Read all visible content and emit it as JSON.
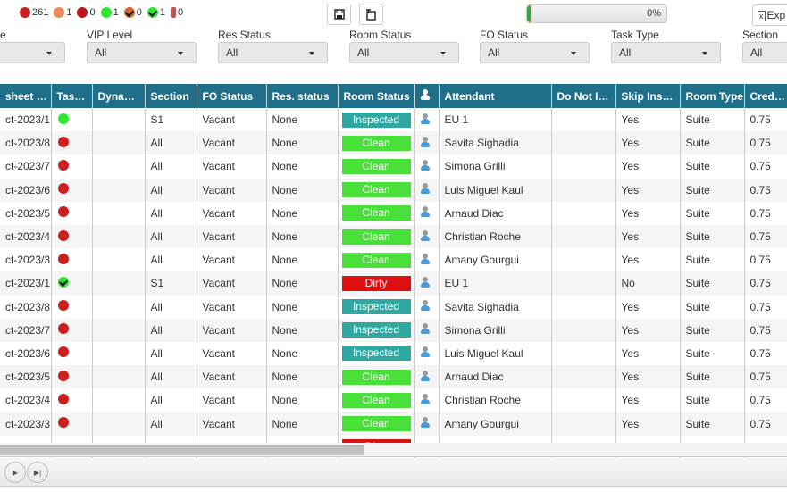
{
  "status_counts": [
    {
      "icon": "red-dot-icon",
      "color": "#cc1f1f",
      "count": "261",
      "check": false
    },
    {
      "icon": "orange-dot-icon",
      "color": "#ee8a55",
      "count": "1",
      "check": false
    },
    {
      "icon": "red-pause-icon",
      "color": "#c0141a",
      "count": "0",
      "check": false
    },
    {
      "icon": "green-dot-icon",
      "color": "#2ee62e",
      "count": "1",
      "check": false
    },
    {
      "icon": "orange-check-icon",
      "color": "#d9622b",
      "count": "0",
      "check": true
    },
    {
      "icon": "green-check-icon",
      "color": "#2ee62e",
      "count": "1",
      "check": true
    },
    {
      "icon": "tag-icon",
      "color": "#b85555",
      "count": "0",
      "check": false
    }
  ],
  "toolbar": {
    "progress_label": "0%",
    "progress_value": 0,
    "export_label": "Exp"
  },
  "filters": [
    {
      "label": "e",
      "value": ""
    },
    {
      "label": "VIP Level",
      "value": "All"
    },
    {
      "label": "Res Status",
      "value": "All"
    },
    {
      "label": "Room Status",
      "value": "All"
    },
    {
      "label": "FO Status",
      "value": "All"
    },
    {
      "label": "Task Type",
      "value": "All"
    },
    {
      "label": "Section",
      "value": "All"
    }
  ],
  "columns": [
    "sheet na…",
    "Tas…",
    "Dyna…",
    "Section",
    "FO Status",
    "Res. status",
    "Room Status",
    "",
    "Attendant",
    "Do Not In…",
    "Skip Insp…",
    "Room Type",
    "Credits"
  ],
  "colors": {
    "Inspected": "#2ea8a0",
    "Clean": "#4ae03a",
    "Dirty": "#e01010",
    "header": "#1f6f8b"
  },
  "rows": [
    {
      "sheet": "ct-2023/1",
      "task": "green",
      "section": "S1",
      "fo": "Vacant",
      "res": "None",
      "room": "Inspected",
      "attendant": "EU 1",
      "dni": "",
      "skip": "Yes",
      "type": "Suite",
      "credits": "0.75"
    },
    {
      "sheet": "ct-2023/8…",
      "task": "red",
      "section": "All",
      "fo": "Vacant",
      "res": "None",
      "room": "Clean",
      "attendant": "Savita Sighadia",
      "dni": "",
      "skip": "Yes",
      "type": "Suite",
      "credits": "0.75"
    },
    {
      "sheet": "ct-2023/7…",
      "task": "red",
      "section": "All",
      "fo": "Vacant",
      "res": "None",
      "room": "Clean",
      "attendant": "Simona Grilli",
      "dni": "",
      "skip": "Yes",
      "type": "Suite",
      "credits": "0.75"
    },
    {
      "sheet": "ct-2023/6…",
      "task": "red",
      "section": "All",
      "fo": "Vacant",
      "res": "None",
      "room": "Clean",
      "attendant": "Luis Miguel Kaul",
      "dni": "",
      "skip": "Yes",
      "type": "Suite",
      "credits": "0.75"
    },
    {
      "sheet": "ct-2023/5…",
      "task": "red",
      "section": "All",
      "fo": "Vacant",
      "res": "None",
      "room": "Clean",
      "attendant": "Arnaud Diac",
      "dni": "",
      "skip": "Yes",
      "type": "Suite",
      "credits": "0.75"
    },
    {
      "sheet": "ct-2023/4…",
      "task": "red",
      "section": "All",
      "fo": "Vacant",
      "res": "None",
      "room": "Clean",
      "attendant": "Christian Roche",
      "dni": "",
      "skip": "Yes",
      "type": "Suite",
      "credits": "0.75"
    },
    {
      "sheet": "ct-2023/3…",
      "task": "red",
      "section": "All",
      "fo": "Vacant",
      "res": "None",
      "room": "Clean",
      "attendant": "Amany Gourgui",
      "dni": "",
      "skip": "Yes",
      "type": "Suite",
      "credits": "0.75"
    },
    {
      "sheet": "ct-2023/1",
      "task": "green-check",
      "section": "S1",
      "fo": "Vacant",
      "res": "None",
      "room": "Dirty",
      "attendant": "EU 1",
      "dni": "",
      "skip": "No",
      "type": "Suite",
      "credits": "0.75"
    },
    {
      "sheet": "ct-2023/8…",
      "task": "red",
      "section": "All",
      "fo": "Vacant",
      "res": "None",
      "room": "Inspected",
      "attendant": "Savita Sighadia",
      "dni": "",
      "skip": "Yes",
      "type": "Suite",
      "credits": "0.75"
    },
    {
      "sheet": "ct-2023/7…",
      "task": "red",
      "section": "All",
      "fo": "Vacant",
      "res": "None",
      "room": "Inspected",
      "attendant": "Simona Grilli",
      "dni": "",
      "skip": "Yes",
      "type": "Suite",
      "credits": "0.75"
    },
    {
      "sheet": "ct-2023/6…",
      "task": "red",
      "section": "All",
      "fo": "Vacant",
      "res": "None",
      "room": "Inspected",
      "attendant": "Luis Miguel Kaul",
      "dni": "",
      "skip": "Yes",
      "type": "Suite",
      "credits": "0.75"
    },
    {
      "sheet": "ct-2023/5…",
      "task": "red",
      "section": "All",
      "fo": "Vacant",
      "res": "None",
      "room": "Clean",
      "attendant": "Arnaud Diac",
      "dni": "",
      "skip": "Yes",
      "type": "Suite",
      "credits": "0.75"
    },
    {
      "sheet": "ct-2023/4…",
      "task": "red",
      "section": "All",
      "fo": "Vacant",
      "res": "None",
      "room": "Clean",
      "attendant": "Christian Roche",
      "dni": "",
      "skip": "Yes",
      "type": "Suite",
      "credits": "0.75"
    },
    {
      "sheet": "ct-2023/3…",
      "task": "red",
      "section": "All",
      "fo": "Vacant",
      "res": "None",
      "room": "Clean",
      "attendant": "Amany Gourgui",
      "dni": "",
      "skip": "Yes",
      "type": "Suite",
      "credits": "0.75"
    },
    {
      "sheet": "",
      "task": "",
      "section": "",
      "fo": "",
      "res": "",
      "room": "Dirty",
      "attendant": "",
      "dni": "",
      "skip": "",
      "type": "",
      "credits": ""
    }
  ]
}
